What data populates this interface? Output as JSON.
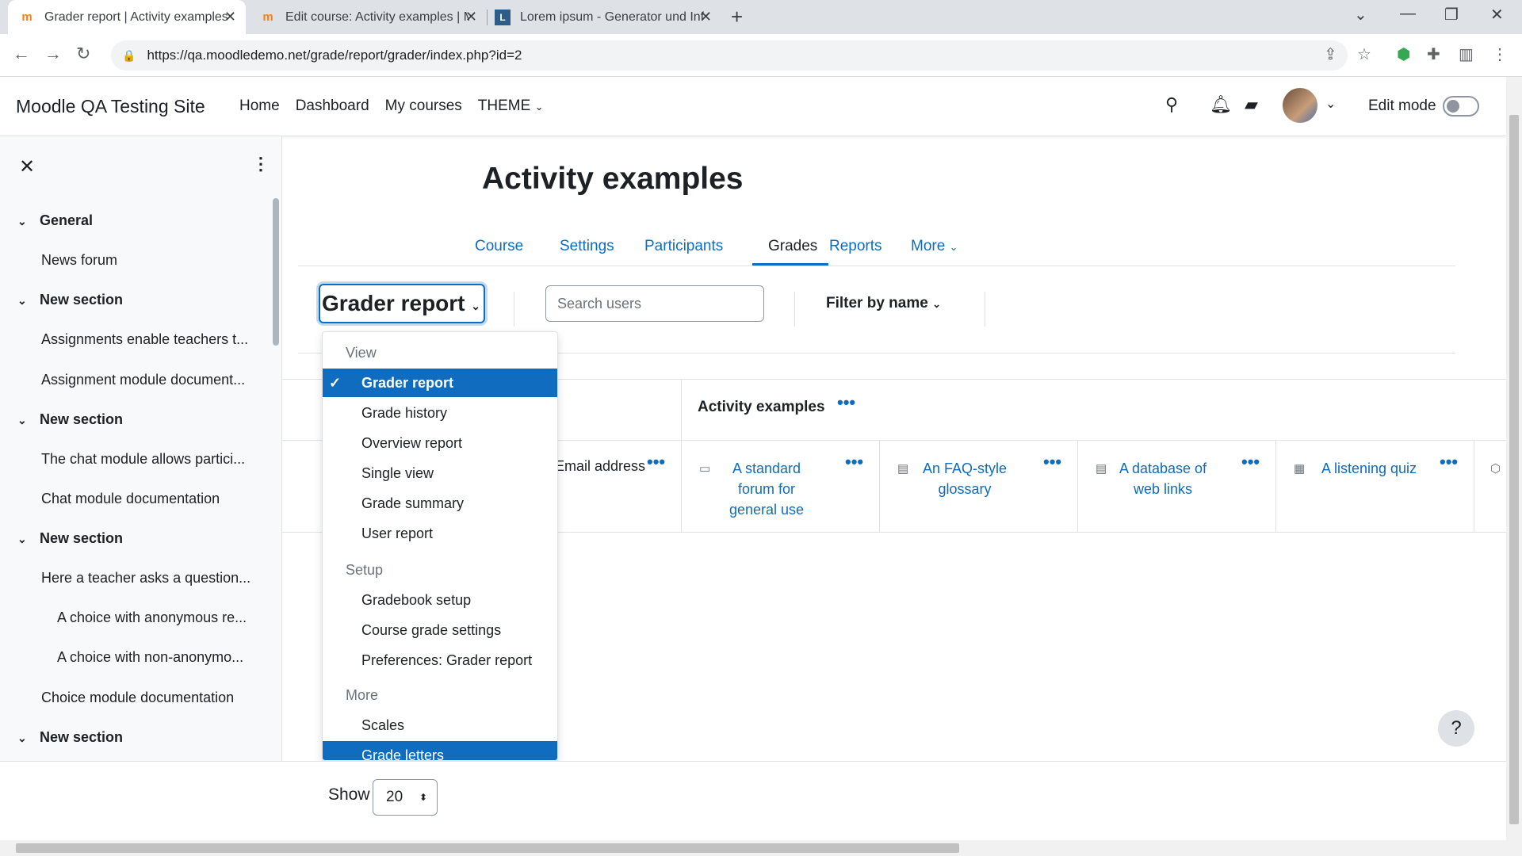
{
  "browser": {
    "tabs": [
      {
        "title": "Grader report | Activity examples",
        "icon": "moodle-icon"
      },
      {
        "title": "Edit course: Activity examples | M",
        "icon": "moodle-icon"
      },
      {
        "title": "Lorem ipsum - Generator und Inf",
        "icon": "document-icon"
      }
    ],
    "url": "https://qa.moodledemo.net/grade/report/grader/index.php?id=2"
  },
  "navbar": {
    "site_name": "Moodle QA Testing Site",
    "items": [
      "Home",
      "Dashboard",
      "My courses",
      "THEME"
    ],
    "edit_mode_label": "Edit mode"
  },
  "drawer": {
    "items": [
      {
        "type": "section",
        "label": "General"
      },
      {
        "type": "activity",
        "label": "News forum"
      },
      {
        "type": "section",
        "label": "New section"
      },
      {
        "type": "activity",
        "label": "Assignments enable teachers t..."
      },
      {
        "type": "activity",
        "label": "Assignment module document..."
      },
      {
        "type": "section",
        "label": "New section"
      },
      {
        "type": "activity",
        "label": "The chat module allows partici..."
      },
      {
        "type": "activity",
        "label": "Chat module documentation"
      },
      {
        "type": "section",
        "label": "New section"
      },
      {
        "type": "activity",
        "label": "Here a teacher asks a question..."
      },
      {
        "type": "sub",
        "label": "A choice with anonymous re..."
      },
      {
        "type": "sub",
        "label": "A choice with non-anonymo..."
      },
      {
        "type": "activity",
        "label": "Choice module documentation"
      },
      {
        "type": "section",
        "label": "New section"
      }
    ]
  },
  "page": {
    "title": "Activity examples",
    "tabs": [
      "Course",
      "Settings",
      "Participants",
      "Grades",
      "Reports",
      "More"
    ],
    "active_tab": "Grades"
  },
  "toolbar": {
    "report_select": "Grader report",
    "search_placeholder": "Search users",
    "filter_label": "Filter by name"
  },
  "table": {
    "category": "Activity examples",
    "email_header": "Email address",
    "columns": [
      {
        "name": "A standard forum for general use",
        "icon": "forum-icon"
      },
      {
        "name": "An FAQ-style glossary",
        "icon": "glossary-icon"
      },
      {
        "name": "A database of web links",
        "icon": "database-icon"
      },
      {
        "name": "A listening quiz",
        "icon": "quiz-icon"
      }
    ]
  },
  "dropdown": {
    "headers": [
      "View",
      "Setup",
      "More"
    ],
    "view_items": [
      "Grader report",
      "Grade history",
      "Overview report",
      "Single view",
      "Grade summary",
      "User report"
    ],
    "setup_items": [
      "Gradebook setup",
      "Course grade settings",
      "Preferences: Grader report"
    ],
    "more_items": [
      "Scales",
      "Grade letters"
    ],
    "selected": "Grader report",
    "highlighted": "Grade letters"
  },
  "footer": {
    "show_label": "Show",
    "per_page": "20"
  },
  "help_label": "?",
  "colors": {
    "primary": "#0f6cbf",
    "text": "#1d2125",
    "drawer_bg": "#f8f9fa"
  }
}
